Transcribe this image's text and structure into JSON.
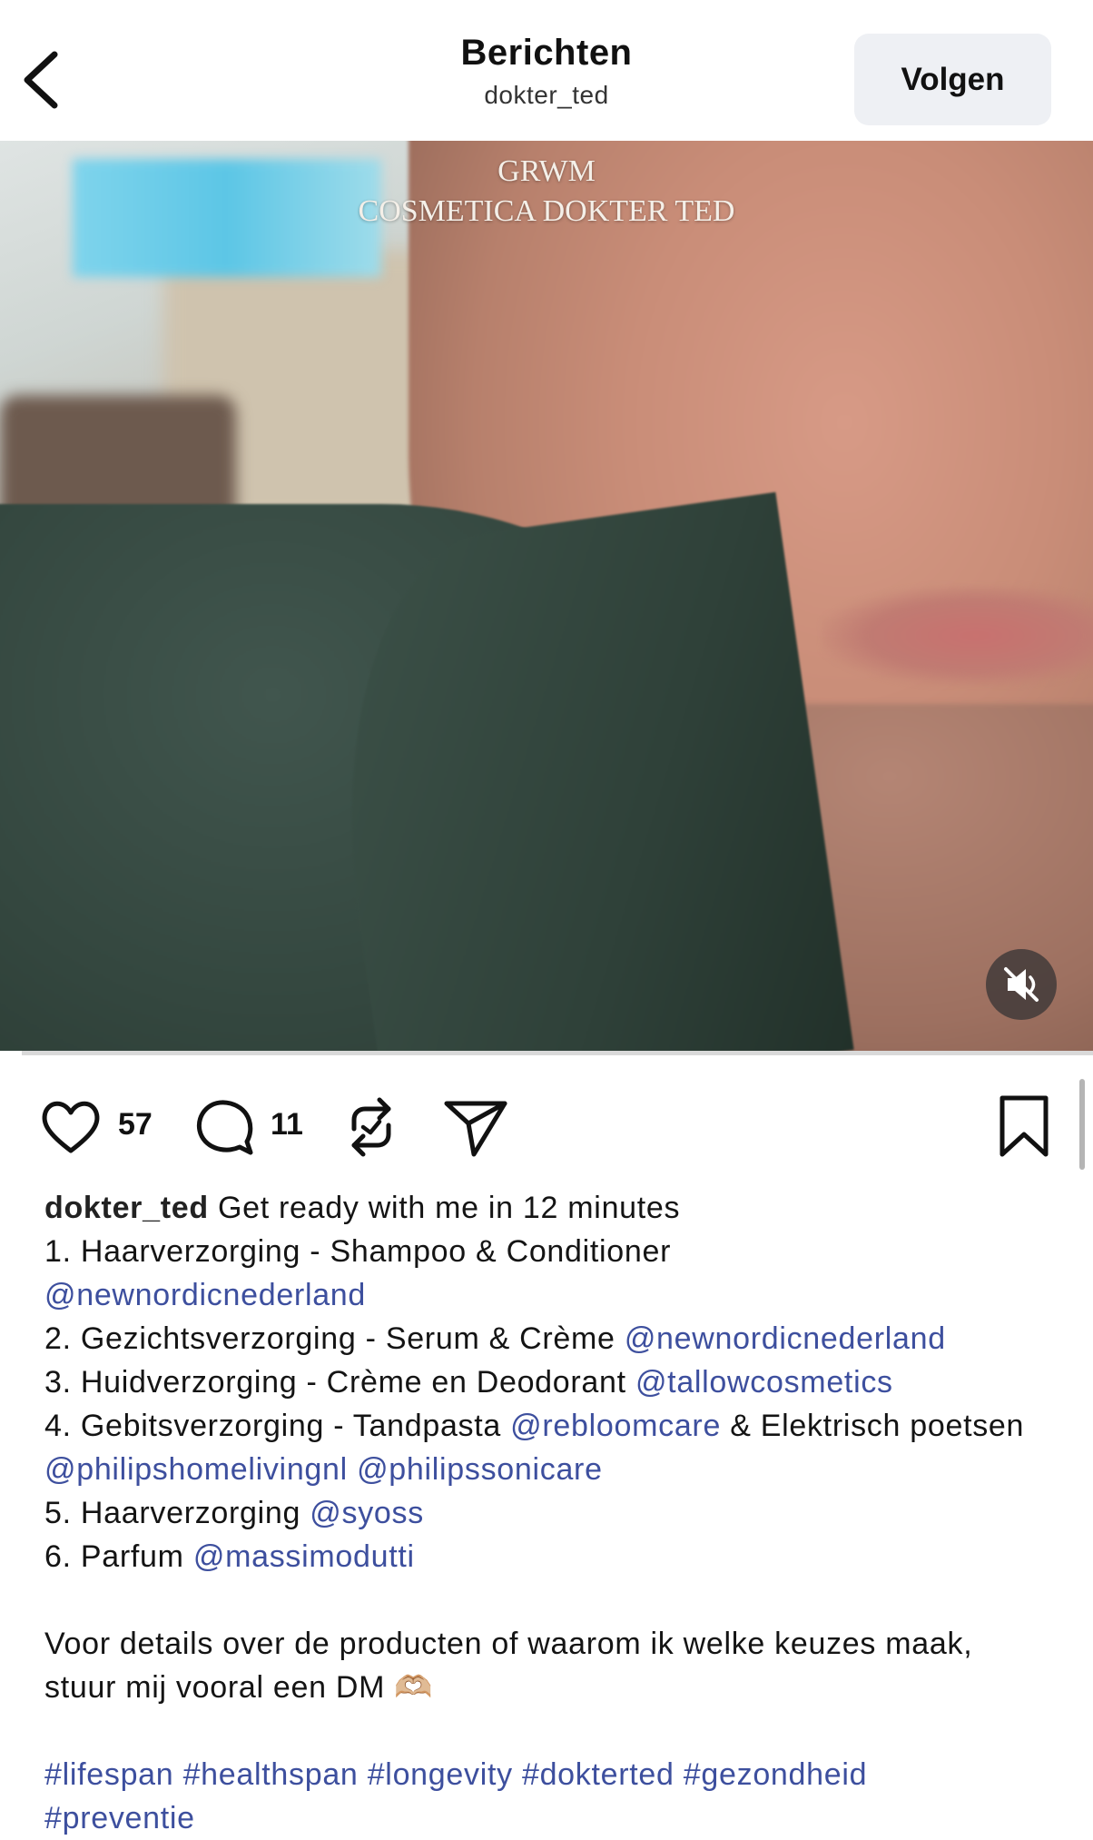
{
  "header": {
    "title": "Berichten",
    "subtitle": "dokter_ted",
    "back_icon": "chevron-left-icon",
    "follow_label": "Volgen"
  },
  "media": {
    "overlay_line1": "GRWM",
    "overlay_line2": "COSMETICA DOKTER TED",
    "mute_icon": "speaker-muted-icon",
    "progress_fraction": 0.02
  },
  "actions": {
    "likes": "57",
    "comments": "11",
    "like_icon": "heart-icon",
    "comment_icon": "comment-bubble-icon",
    "repost_icon": "repost-icon",
    "share_icon": "paper-plane-icon",
    "save_icon": "bookmark-icon"
  },
  "caption": {
    "username": "dokter_ted",
    "intro": "Get ready with me in 12 minutes",
    "line1_text": "1. Haarverzorging - Shampoo & Conditioner",
    "line1_mention": "@newnordicnederland",
    "line2_text": "2. Gezichtsverzorging - Serum & Crème",
    "line2_mention": "@newnordicnederland",
    "line3_text": "3. Huidverzorging - Crème en Deodorant",
    "line3_mention": "@tallowcosmetics",
    "line4_text_a": "4. Gebitsverzorging - Tandpasta",
    "line4_mention_a": "@rebloomcare",
    "line4_text_b": "& Elektrisch poetsen",
    "line4_mention_b": "@philipshomelivingnl",
    "line4_mention_c": "@philipssonicare",
    "line5_text": "5. Haarverzorging",
    "line5_mention": "@syoss",
    "line6_text": "6. Parfum",
    "line6_mention": "@massimodutti",
    "details": "Voor details over de producten of waarom ik welke keuzes maak, stuur mij vooral een DM 🫶🏼",
    "hashtags": [
      "#lifespan",
      "#healthspan",
      "#longevity",
      "#dokterted",
      "#gezondheid",
      "#preventie"
    ]
  }
}
